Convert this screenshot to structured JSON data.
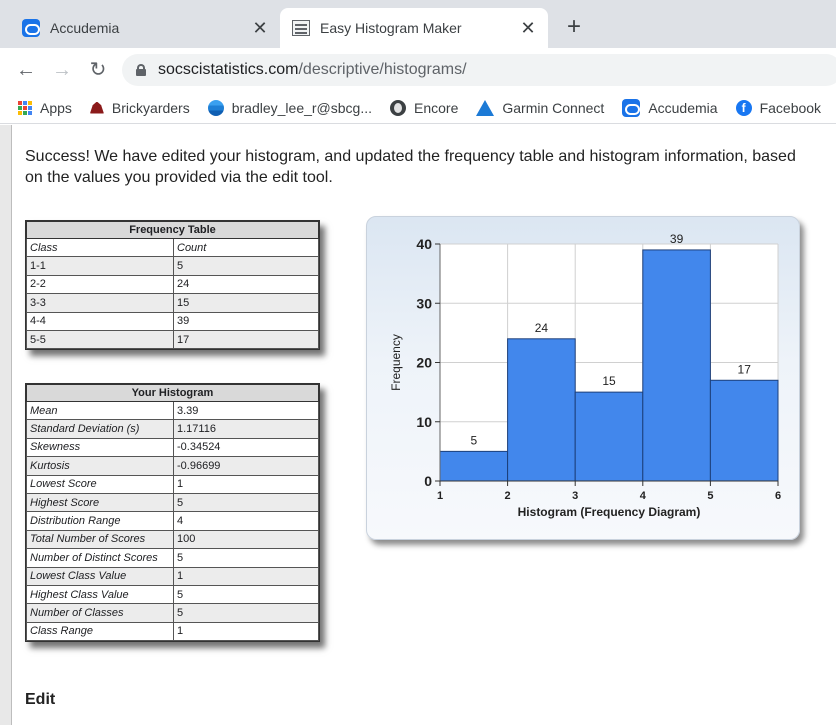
{
  "browser": {
    "tabs": [
      {
        "title": "Accudemia",
        "active": false,
        "icon": "cloud-icon"
      },
      {
        "title": "Easy Histogram Maker",
        "active": true,
        "icon": "histogram-doc-icon"
      }
    ],
    "url_domain": "socscistatistics.com",
    "url_path": "/descriptive/histograms/",
    "bookmarks": [
      {
        "label": "Apps",
        "icon": "apps-grid-icon"
      },
      {
        "label": "Brickyarders",
        "icon": "brickyarders-icon"
      },
      {
        "label": "bradley_lee_r@sbcg...",
        "icon": "mail-icon"
      },
      {
        "label": "Encore",
        "icon": "globe-icon"
      },
      {
        "label": "Garmin Connect",
        "icon": "garmin-triangle-icon"
      },
      {
        "label": "Accudemia",
        "icon": "cloud-icon"
      },
      {
        "label": "Facebook",
        "icon": "facebook-icon"
      }
    ]
  },
  "page": {
    "success_message": "Success! We have edited your histogram, and updated the frequency table and histogram information, based on the values you provided via the edit tool.",
    "edit_heading": "Edit"
  },
  "frequency_table": {
    "title": "Frequency Table",
    "headers": [
      "Class",
      "Count"
    ],
    "rows": [
      [
        "1-1",
        "5"
      ],
      [
        "2-2",
        "24"
      ],
      [
        "3-3",
        "15"
      ],
      [
        "4-4",
        "39"
      ],
      [
        "5-5",
        "17"
      ]
    ]
  },
  "histogram_stats": {
    "title": "Your Histogram",
    "rows": [
      [
        "Mean",
        "3.39"
      ],
      [
        "Standard Deviation (s)",
        "1.17116"
      ],
      [
        "Skewness",
        "-0.34524"
      ],
      [
        "Kurtosis",
        "-0.96699"
      ],
      [
        "Lowest Score",
        "1"
      ],
      [
        "Highest Score",
        "5"
      ],
      [
        "Distribution Range",
        "4"
      ],
      [
        "Total Number of Scores",
        "100"
      ],
      [
        "Number of Distinct Scores",
        "5"
      ],
      [
        "Lowest Class Value",
        "1"
      ],
      [
        "Highest Class Value",
        "5"
      ],
      [
        "Number of Classes",
        "5"
      ],
      [
        "Class Range",
        "1"
      ]
    ]
  },
  "chart_data": {
    "type": "bar",
    "bins": [
      [
        1,
        2
      ],
      [
        2,
        3
      ],
      [
        3,
        4
      ],
      [
        4,
        5
      ],
      [
        5,
        6
      ]
    ],
    "values": [
      5,
      24,
      15,
      39,
      17
    ],
    "data_labels": [
      "5",
      "24",
      "15",
      "39",
      "17"
    ],
    "x_ticks": [
      "1",
      "2",
      "3",
      "4",
      "5",
      "6"
    ],
    "y_ticks": [
      "0",
      "10",
      "20",
      "30",
      "40"
    ],
    "xlim": [
      1,
      6
    ],
    "ylim": [
      0,
      40
    ],
    "xlabel": "Histogram (Frequency Diagram)",
    "ylabel": "Frequency",
    "grid": true,
    "bar_color": "#4287ec"
  }
}
